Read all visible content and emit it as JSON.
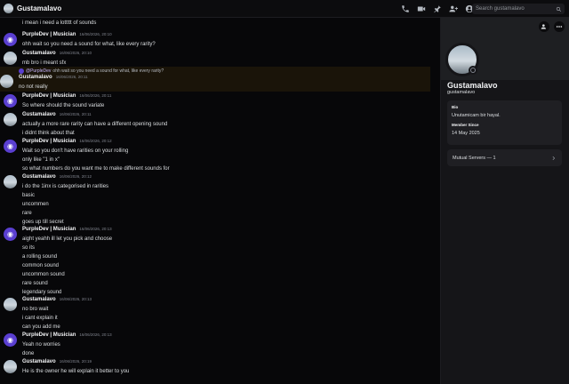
{
  "topbar": {
    "dm_name": "Gustamalavo",
    "search_placeholder": "Search gustamalavo",
    "icons": [
      "phone-icon",
      "video-icon",
      "pin-icon",
      "add-friends-icon",
      "profile-icon",
      "search-icon"
    ]
  },
  "colors": {
    "accent": "#5a3fd1",
    "reply_highlight": "#1a1409",
    "background": "#070709"
  },
  "chat": {
    "top_line": "i mean i need a lottttt of sounds",
    "messages": [
      {
        "author": "PurpleDev | Musician",
        "time": "16/06/2026, 20:10",
        "av": "p",
        "lines": [
          "ohh wait so you need a sound for what, like every rarity?"
        ]
      },
      {
        "author": "Gustamalavo",
        "time": "16/06/2026, 20:10",
        "av": "g",
        "lines": [
          "mb bro i meant sfx"
        ]
      },
      {
        "author": "Gustamalavo",
        "time": "16/06/2026, 20:11",
        "av": "g",
        "reply": {
          "author": "@PurpleDev",
          "text": "ohh wait so you need a sound for what, like every rarity?"
        },
        "lines": [
          "no not really"
        ]
      },
      {
        "author": "PurpleDev | Musician",
        "time": "16/06/2026, 20:11",
        "av": "p",
        "lines": [
          "So where should the sound variate"
        ]
      },
      {
        "author": "Gustamalavo",
        "time": "16/06/2026, 20:11",
        "av": "g",
        "lines": [
          "actually a more rare rarity can have a different opening sound",
          "i didnt think about that"
        ]
      },
      {
        "author": "PurpleDev | Musician",
        "time": "16/06/2026, 20:12",
        "av": "p",
        "lines": [
          "Wait so you don't have rarities on your rolling",
          "only like \"1 in x\"",
          "so what numbers do you want me to make different sounds for"
        ]
      },
      {
        "author": "Gustamalavo",
        "time": "16/06/2026, 20:12",
        "av": "g",
        "lines": [
          "i do the 1inx is categorised in rarities",
          "basic",
          "uncommen",
          "rare",
          "goes up till secret"
        ]
      },
      {
        "author": "PurpleDev | Musician",
        "time": "16/06/2026, 20:13",
        "av": "p",
        "lines": [
          "aight yeahh ill let you pick and choose",
          "so its",
          "a rolling sound",
          "common sound",
          "uncommon sound",
          "rare sound",
          "legendary sound"
        ]
      },
      {
        "author": "Gustamalavo",
        "time": "16/06/2026, 20:13",
        "av": "g",
        "lines": [
          "no bro wait",
          "i cant explain it",
          "can you add me"
        ]
      },
      {
        "author": "PurpleDev | Musician",
        "time": "16/06/2026, 20:13",
        "av": "p",
        "lines": [
          "Yeah no worries",
          "done"
        ]
      },
      {
        "author": "Gustamalavo",
        "time": "16/06/2026, 20:19",
        "av": "g",
        "lines": [
          "He is the owner he will explain it better to you"
        ]
      }
    ]
  },
  "profile": {
    "display_name": "Gustamalavo",
    "username": "gustamalavo",
    "bio_label": "Bio",
    "bio_text": "Unutamicam bir hayal.",
    "member_since_label": "Member Since",
    "member_since": "14 May 2025",
    "mutual_servers": "Mutual Servers — 1"
  }
}
